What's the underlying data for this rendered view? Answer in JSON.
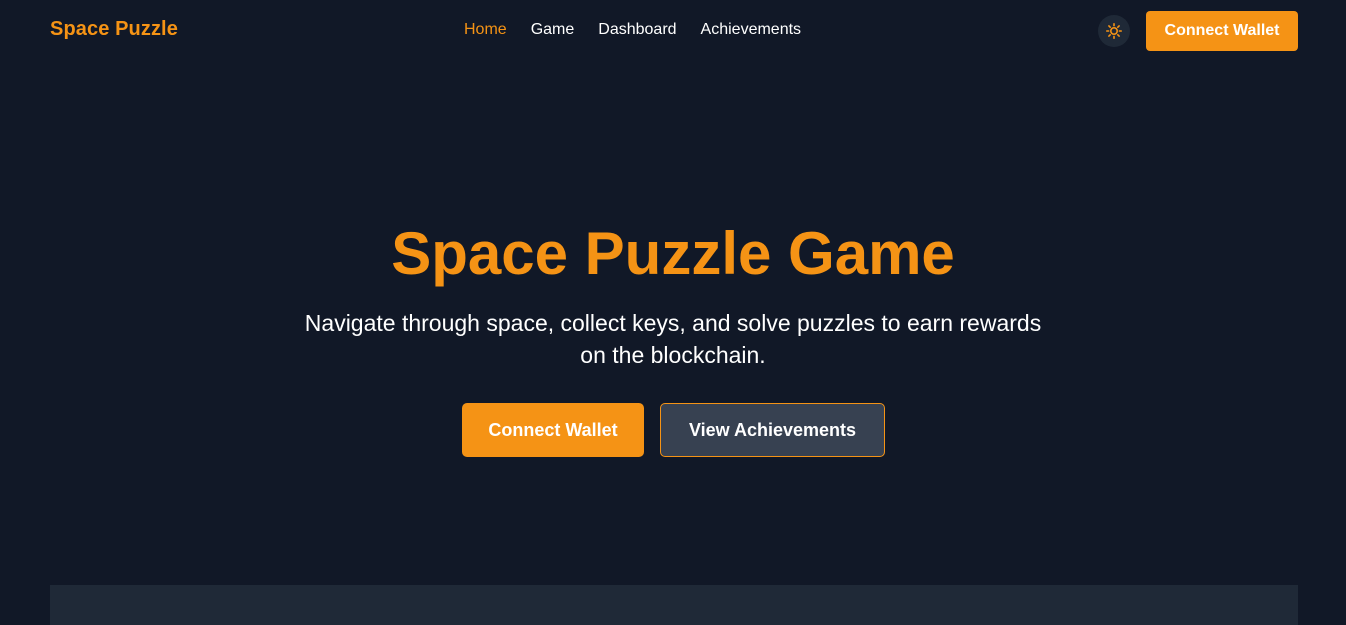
{
  "header": {
    "brand": "Space Puzzle",
    "nav": [
      {
        "label": "Home",
        "active": true
      },
      {
        "label": "Game",
        "active": false
      },
      {
        "label": "Dashboard",
        "active": false
      },
      {
        "label": "Achievements",
        "active": false
      }
    ],
    "theme_toggle_icon": "sun-icon",
    "connect_label": "Connect Wallet"
  },
  "hero": {
    "title": "Space Puzzle Game",
    "subtitle": "Navigate through space, collect keys, and solve puzzles to earn rewards on the blockchain.",
    "primary_label": "Connect Wallet",
    "secondary_label": "View Achievements"
  },
  "colors": {
    "background": "#111827",
    "accent": "#f59315",
    "surface": "#1f2937",
    "button_secondary": "#374151",
    "text": "#ffffff"
  }
}
